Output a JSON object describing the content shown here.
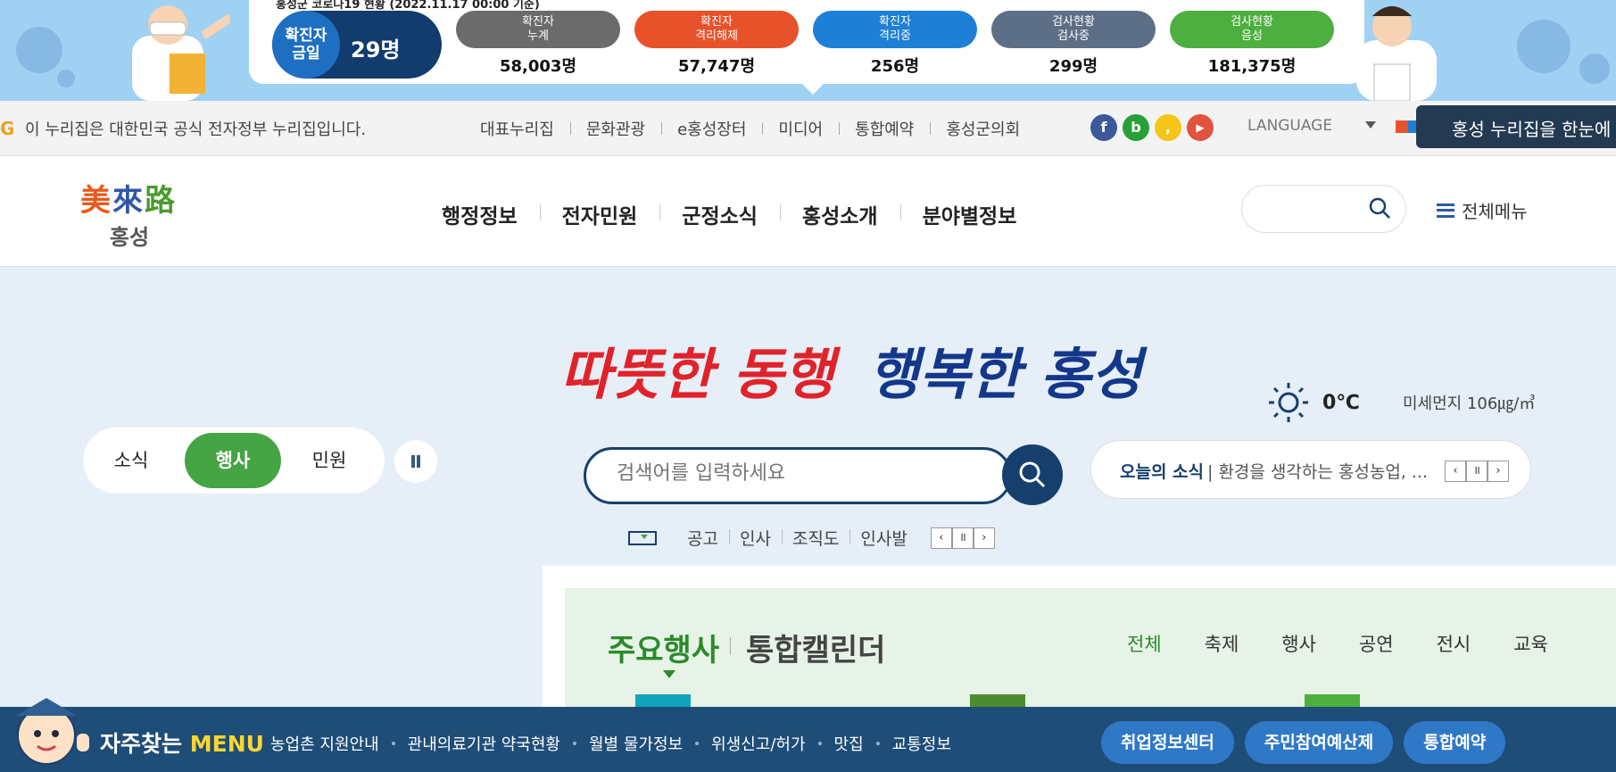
{
  "covid": {
    "ticker": "홍성군 코로나19 현황 (2022.11.17 00:00 기준)",
    "today": {
      "label": "확진자\n금일",
      "value": "29명"
    },
    "stats": [
      {
        "label": "확진자\n누계",
        "value": "58,003명",
        "color": "#6b6b6b"
      },
      {
        "label": "확진자\n격리해제",
        "value": "57,747명",
        "color": "#e8522a"
      },
      {
        "label": "확진자\n격리중",
        "value": "256명",
        "color": "#1e7fd6"
      },
      {
        "label": "검사현황\n검사중",
        "value": "299명",
        "color": "#5d6f86"
      },
      {
        "label": "검사현황\n음성",
        "value": "181,375명",
        "color": "#4caf3f"
      }
    ]
  },
  "util": {
    "gov_notice": "이 누리집은 대한민국 공식 전자정부 누리집입니다.",
    "links": [
      "대표누리집",
      "문화관광",
      "e홍성장터",
      "미디어",
      "통합예약",
      "홍성군의회"
    ],
    "sns": [
      {
        "icon": "facebook-icon",
        "glyph": "f",
        "color": "#3b5998"
      },
      {
        "icon": "blog-icon",
        "glyph": "b",
        "color": "#27a039"
      },
      {
        "icon": "kakao-icon",
        "glyph": "❜",
        "color": "#f5c518"
      },
      {
        "icon": "youtube-icon",
        "glyph": "▶",
        "color": "#e0533d"
      }
    ],
    "language": "LANGUAGE",
    "hongsung_btn": "홍성 누리집을 한눈에"
  },
  "header": {
    "logo_top": [
      "美",
      "來",
      "路"
    ],
    "logo_sub": "홍성",
    "gnb": [
      "행정정보",
      "전자민원",
      "군정소식",
      "홍성소개",
      "분야별정보"
    ],
    "all_menu": "전체메뉴"
  },
  "hero": {
    "slogan_red": "따뜻한 동행",
    "slogan_blue": "행복한 홍성",
    "tabs": [
      "소식",
      "행사",
      "민원"
    ],
    "active_tab": "행사",
    "search_placeholder": "검색어를 입력하세요",
    "keywords": [
      "공고",
      "인사",
      "조직도",
      "인사발"
    ],
    "weather": {
      "temp": "0℃",
      "dust": "미세먼지 106㎍/㎥"
    },
    "news": {
      "label": "오늘의 소식",
      "text": "| 환경을 생각하는 홍성농업, ..."
    },
    "events": {
      "title": "주요행사",
      "title2": "통합캘린더",
      "tabs": [
        "전체",
        "축제",
        "행사",
        "공연",
        "전시",
        "교육"
      ],
      "active_tab": "전체"
    }
  },
  "freq_menu": {
    "title_a": "자주찾는",
    "title_b": "MENU",
    "links": [
      "농업촌 지원안내",
      "관내의료기관 약국현황",
      "월별 물가정보",
      "위생신고/허가",
      "맛집",
      "교통정보"
    ],
    "buttons": [
      "취업정보센터",
      "주민참여예산제",
      "통합예약"
    ]
  }
}
